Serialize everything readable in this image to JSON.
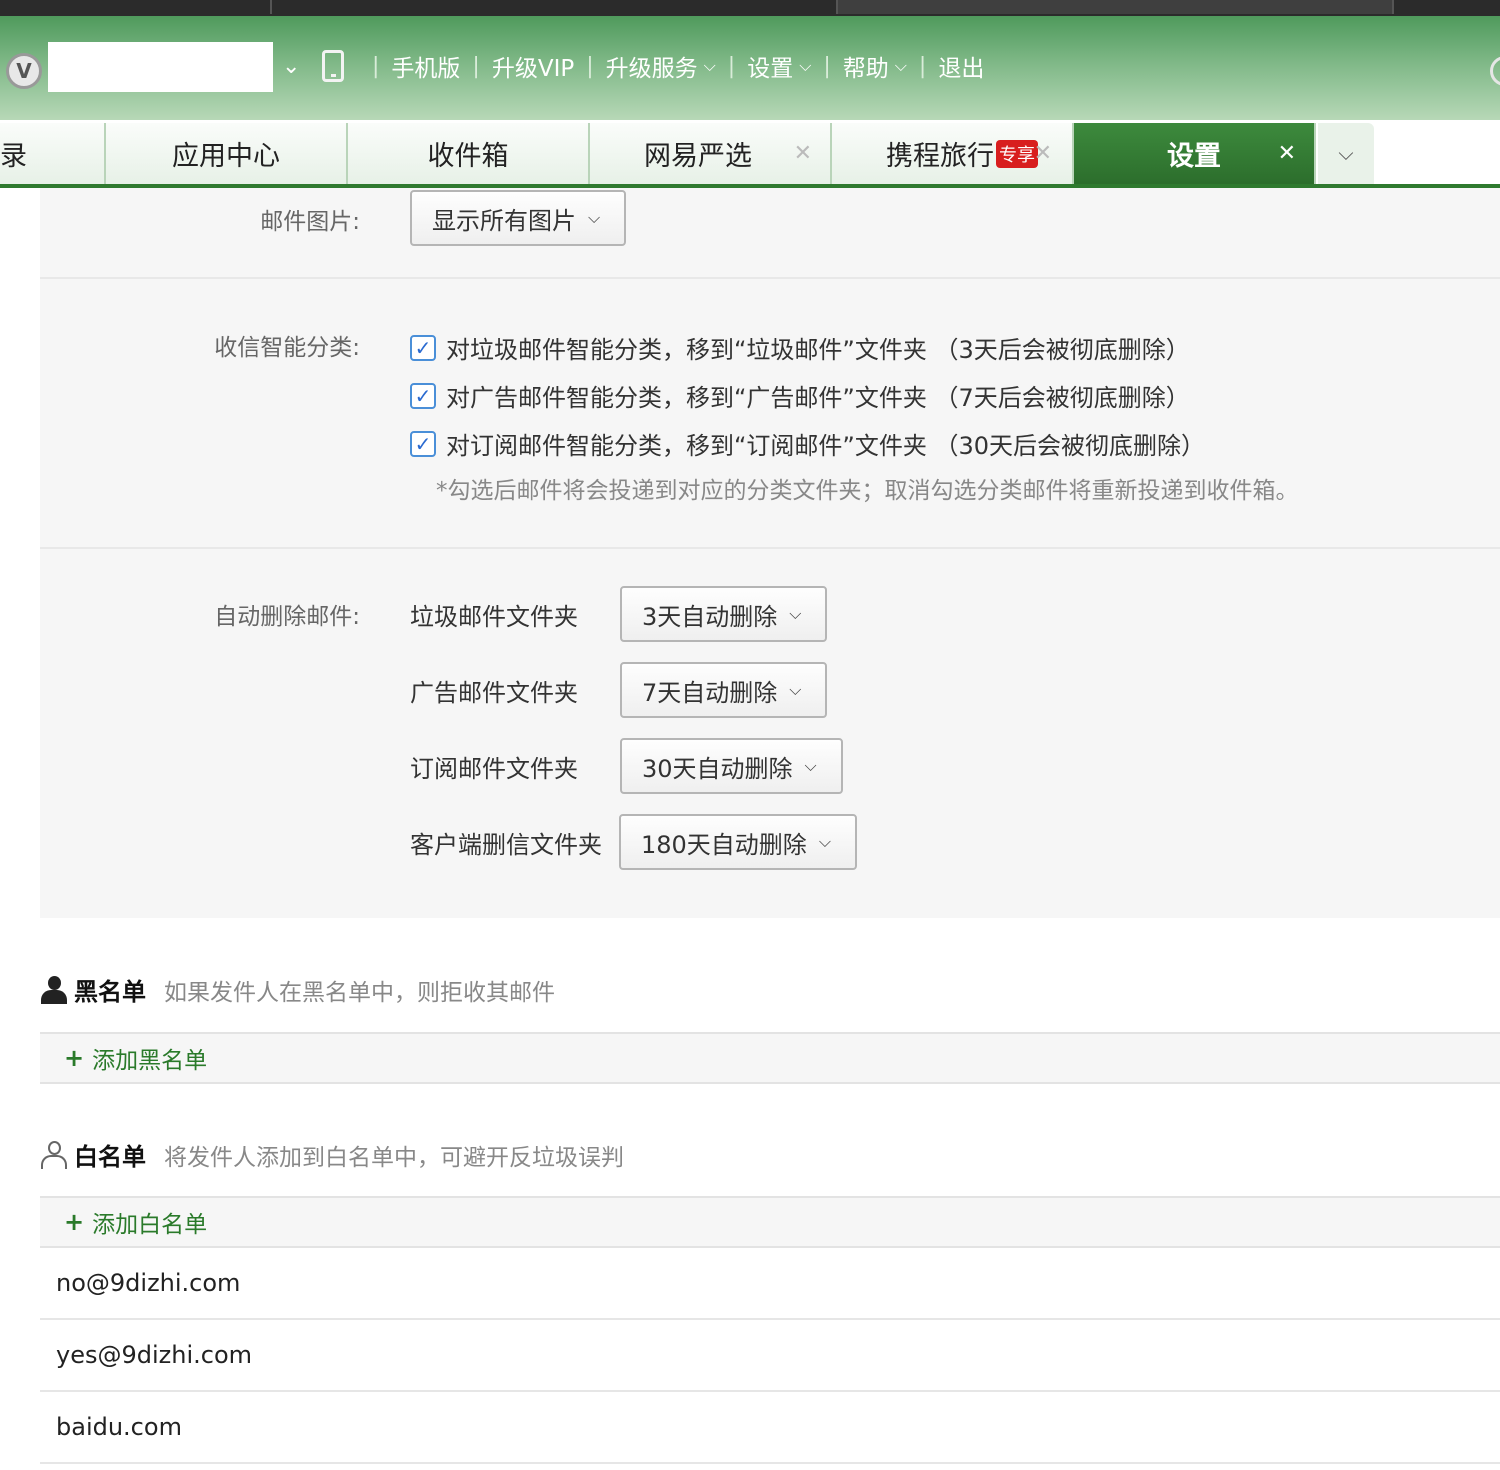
{
  "header": {
    "nav": [
      {
        "label": "手机版",
        "dropdown": false
      },
      {
        "label": "升级VIP",
        "dropdown": false
      },
      {
        "label": "升级服务",
        "dropdown": true
      },
      {
        "label": "设置",
        "dropdown": true
      },
      {
        "label": "帮助",
        "dropdown": true
      },
      {
        "label": "退出",
        "dropdown": false
      }
    ],
    "logo_letter": "V"
  },
  "tabs": [
    {
      "label": "录",
      "closable": false,
      "active": false
    },
    {
      "label": "应用中心",
      "closable": false,
      "active": false
    },
    {
      "label": "收件箱",
      "closable": false,
      "active": false
    },
    {
      "label": "网易严选",
      "closable": true,
      "active": false
    },
    {
      "label": "携程旅行",
      "badge": "专享",
      "closable": true,
      "active": false
    },
    {
      "label": "设置",
      "closable": true,
      "active": true
    }
  ],
  "settings": {
    "mail_images": {
      "label": "邮件图片:",
      "value": "显示所有图片"
    },
    "smart_classify": {
      "label": "收信智能分类:",
      "options": [
        {
          "text": "对垃圾邮件智能分类，移到“垃圾邮件”文件夹 （3天后会被彻底删除）",
          "checked": true
        },
        {
          "text": "对广告邮件智能分类，移到“广告邮件”文件夹 （7天后会被彻底删除）",
          "checked": true
        },
        {
          "text": "对订阅邮件智能分类，移到“订阅邮件”文件夹 （30天后会被彻底删除）",
          "checked": true
        }
      ],
      "hint": "*勾选后邮件将会投递到对应的分类文件夹；取消勾选分类邮件将重新投递到收件箱。"
    },
    "auto_delete": {
      "label": "自动删除邮件:",
      "rows": [
        {
          "folder": "垃圾邮件文件夹",
          "value": "3天自动删除"
        },
        {
          "folder": "广告邮件文件夹",
          "value": "7天自动删除"
        },
        {
          "folder": "订阅邮件文件夹",
          "value": "30天自动删除"
        },
        {
          "folder": "客户端删信文件夹",
          "value": "180天自动删除"
        }
      ]
    }
  },
  "blacklist": {
    "title": "黑名单",
    "desc": "如果发件人在黑名单中，则拒收其邮件",
    "add_label": "添加黑名单"
  },
  "whitelist": {
    "title": "白名单",
    "desc": "将发件人添加到白名单中，可避开反垃圾误判",
    "add_label": "添加白名单",
    "entries": [
      "no@9dizhi.com",
      "yes@9dizhi.com",
      "baidu.com"
    ]
  },
  "colors": {
    "header_green": "#4f9a5c",
    "active_tab": "#2c6e2c",
    "link_green": "#2a7a2a",
    "badge_red": "#d81e1e"
  }
}
